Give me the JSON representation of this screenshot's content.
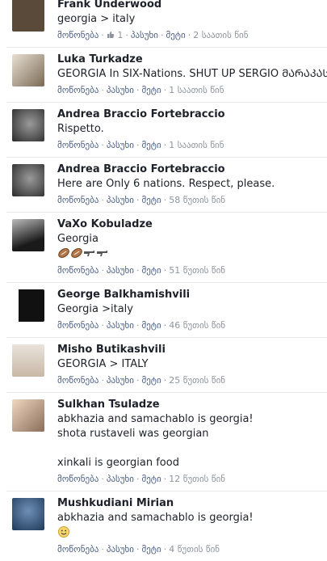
{
  "labels": {
    "like": "მოწონება",
    "reply": "პასუხი",
    "more": "მეტი"
  },
  "comments": [
    {
      "author": "Frank Underwood",
      "text": "georgia > italy",
      "likes": "1",
      "time": "2 საათის წინ",
      "avatar_color": "#5a4a3a"
    },
    {
      "author": "Luka Turkadze",
      "text": "GEORGIA In SIX-Nations. SHUT UP SERGIO ᲛᲐᲠᲐᲙᲐᲡᲝ",
      "time": "1 საათის წინ",
      "avatar_color": "#7a6a55"
    },
    {
      "author": "Andrea Braccio Fortebraccio",
      "text": "Rispetto.",
      "time": "1 საათის წინ",
      "avatar_color": "#3a3a3a"
    },
    {
      "author": "Andrea Braccio Fortebraccio",
      "text": "Here are Only 6 nations. Respect, please.",
      "time": "58 წუთის წინ",
      "avatar_color": "#3a3a3a"
    },
    {
      "author": "VaXo Kobuladze",
      "text": "Georgia",
      "time": "51 წუთის წინ",
      "avatar_color": "#2a2a2a"
    },
    {
      "author": "George Balkhamishvili",
      "text": "Georgia >italy",
      "time": "46 წუთის წინ",
      "avatar_color": "#1e1e1e"
    },
    {
      "author": "Misho Butikashvili",
      "text": "GEORGIA > ITALY",
      "time": "25 წუთის წინ",
      "avatar_color": "#c9b8a6"
    },
    {
      "author": "Sulkhan Tsuladze",
      "text": "abkhazia and samachablo is georgia!\nshota rustaveli was georgian\n\nxinkali is georgian food",
      "time": "12 წუთის წინ",
      "avatar_color": "#8a6e5a"
    },
    {
      "author": "Mushkudiani Mirian",
      "text": "abkhazia and samachablo is georgia!",
      "time": "4 წუთის წინ",
      "avatar_color": "#1f3a5a"
    }
  ]
}
